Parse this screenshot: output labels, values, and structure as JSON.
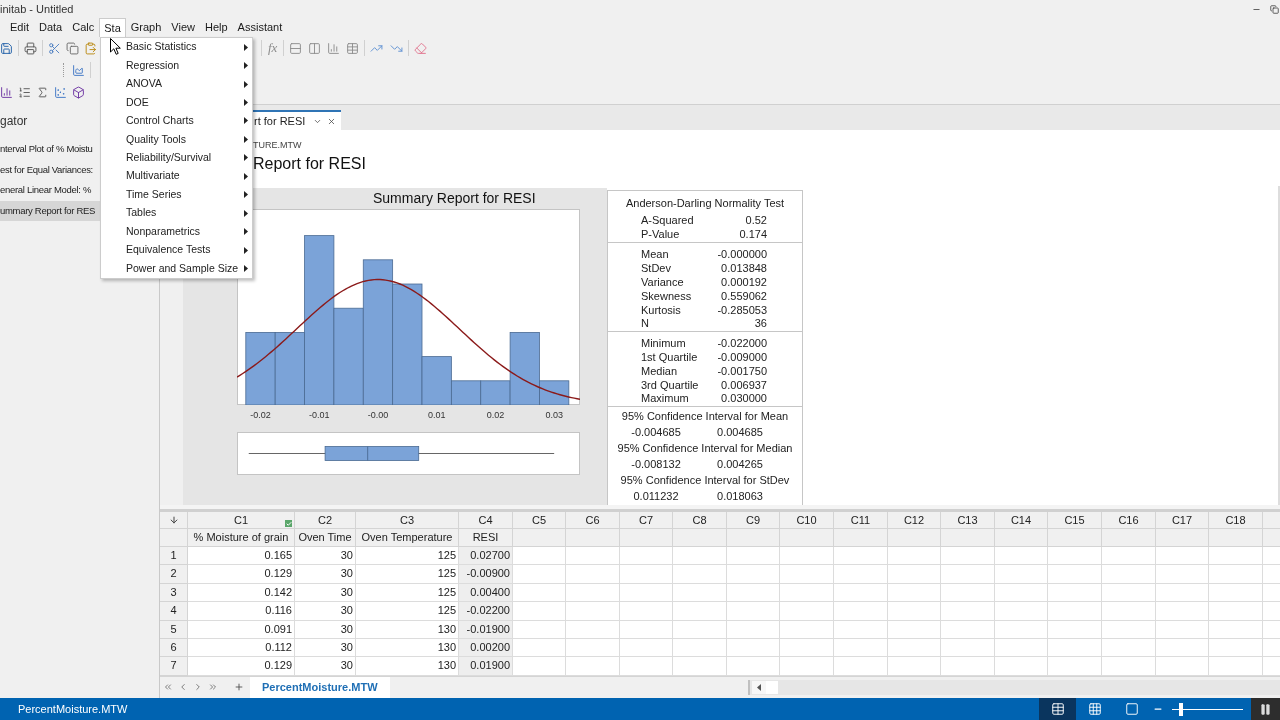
{
  "window": {
    "title": "initab - Untitled"
  },
  "menu_bar": [
    {
      "label": "Edit",
      "selected": false
    },
    {
      "label": "Data",
      "selected": false
    },
    {
      "label": "Calc",
      "selected": false
    },
    {
      "label": "Sta",
      "selected": true
    },
    {
      "label": "Graph",
      "selected": false
    },
    {
      "label": "View",
      "selected": false
    },
    {
      "label": "Help",
      "selected": false
    },
    {
      "label": "Assistant",
      "selected": false
    }
  ],
  "toolbar": {
    "function_label": "fx"
  },
  "stat_menu": {
    "items": [
      {
        "label": "Basic Statistics",
        "submenu": true
      },
      {
        "label": "Regression",
        "submenu": true
      },
      {
        "label": "ANOVA",
        "submenu": true
      },
      {
        "label": "DOE",
        "submenu": true
      },
      {
        "label": "Control Charts",
        "submenu": true
      },
      {
        "label": "Quality Tools",
        "submenu": true
      },
      {
        "label": "Reliability/Survival",
        "submenu": true
      },
      {
        "label": "Multivariate",
        "submenu": true
      },
      {
        "label": "Time Series",
        "submenu": true
      },
      {
        "label": "Tables",
        "submenu": true
      },
      {
        "label": "Nonparametrics",
        "submenu": true
      },
      {
        "label": "Equivalence Tests",
        "submenu": true
      },
      {
        "label": "Power and Sample Size",
        "submenu": true
      }
    ]
  },
  "navigator": {
    "title": "gator",
    "items": [
      {
        "label": "nterval Plot of % Moistu",
        "selected": false
      },
      {
        "label": "est for Equal Variances:",
        "selected": false
      },
      {
        "label": "eneral Linear Model: %",
        "selected": false
      },
      {
        "label": "ummary Report for RES",
        "selected": true
      }
    ]
  },
  "output": {
    "tab": {
      "label": "rt for RESI",
      "selected": true
    },
    "source": "TURE.MTW",
    "heading": "Report for RESI",
    "graph": {
      "title": "Summary Report for RESI",
      "axis_labels": [
        "-0.02",
        "-0.01",
        "-0.00",
        "0.01",
        "0.02",
        "0.03"
      ]
    },
    "summary_table": {
      "title": "Anderson-Darling Normality Test",
      "sections": [
        {
          "rows": [
            {
              "label": "A-Squared",
              "value": "0.52"
            },
            {
              "label": "P-Value",
              "value": "0.174"
            }
          ]
        },
        {
          "rows": [
            {
              "label": "Mean",
              "value": "-0.000000"
            },
            {
              "label": "StDev",
              "value": "0.013848"
            },
            {
              "label": "Variance",
              "value": "0.000192"
            },
            {
              "label": "Skewness",
              "value": "0.559062"
            },
            {
              "label": "Kurtosis",
              "value": "-0.285053"
            },
            {
              "label": "N",
              "value": "36"
            }
          ]
        },
        {
          "rows": [
            {
              "label": "Minimum",
              "value": "-0.022000"
            },
            {
              "label": "1st Quartile",
              "value": "-0.009000"
            },
            {
              "label": "Median",
              "value": "-0.001750"
            },
            {
              "label": "3rd Quartile",
              "value": "0.006937"
            },
            {
              "label": "Maximum",
              "value": "0.030000"
            }
          ]
        }
      ],
      "intervals": [
        {
          "title": "95% Confidence Interval for Mean",
          "low": "-0.004685",
          "high": "0.004685"
        },
        {
          "title": "95% Confidence Interval for Median",
          "low": "-0.008132",
          "high": "0.004265"
        },
        {
          "title": "95% Confidence Interval for StDev",
          "low": "0.011232",
          "high": "0.018063"
        }
      ]
    }
  },
  "worksheet": {
    "columns": [
      {
        "id": "C1",
        "name": "% Moisture of grain",
        "checked": true,
        "shaded": false
      },
      {
        "id": "C2",
        "name": "Oven Time",
        "checked": false,
        "shaded": false
      },
      {
        "id": "C3",
        "name": "Oven Temperature",
        "checked": false,
        "shaded": false
      },
      {
        "id": "C4",
        "name": "RESI",
        "checked": false,
        "shaded": true
      },
      {
        "id": "C5",
        "checked": false,
        "shaded": false
      },
      {
        "id": "C6",
        "checked": false,
        "shaded": false
      },
      {
        "id": "C7",
        "checked": false,
        "shaded": false
      },
      {
        "id": "C8",
        "checked": false,
        "shaded": false
      },
      {
        "id": "C9",
        "checked": false,
        "shaded": false
      },
      {
        "id": "C10",
        "checked": false,
        "shaded": false
      },
      {
        "id": "C11",
        "checked": false,
        "shaded": false
      },
      {
        "id": "C12",
        "checked": false,
        "shaded": false
      },
      {
        "id": "C13",
        "checked": false,
        "shaded": false
      },
      {
        "id": "C14",
        "checked": false,
        "shaded": false
      },
      {
        "id": "C15",
        "checked": false,
        "shaded": false
      },
      {
        "id": "C16",
        "checked": false,
        "shaded": false
      },
      {
        "id": "C17",
        "checked": false,
        "shaded": false
      },
      {
        "id": "C18",
        "checked": false,
        "shaded": false
      }
    ],
    "rows": [
      {
        "number": "1",
        "cells": [
          "0.165",
          "30",
          "125",
          "0.02700"
        ]
      },
      {
        "number": "2",
        "cells": [
          "0.129",
          "30",
          "125",
          "-0.00900"
        ]
      },
      {
        "number": "3",
        "cells": [
          "0.142",
          "30",
          "125",
          "0.00400"
        ]
      },
      {
        "number": "4",
        "cells": [
          "0.116",
          "30",
          "125",
          "-0.02200"
        ]
      },
      {
        "number": "5",
        "cells": [
          "0.091",
          "30",
          "130",
          "-0.01900"
        ]
      },
      {
        "number": "6",
        "cells": [
          "0.112",
          "30",
          "130",
          "0.00200"
        ]
      },
      {
        "number": "7",
        "cells": [
          "0.129",
          "30",
          "130",
          "0.01900"
        ]
      }
    ]
  },
  "sheet_tabs": [
    {
      "label": "PercentMoisture.MTW",
      "selected": true
    }
  ],
  "status_bar": {
    "text": "PercentMoisture.MTW",
    "views": [
      {
        "kind": "worksheet",
        "selected": true
      },
      {
        "kind": "grid",
        "selected": false
      },
      {
        "kind": "single",
        "selected": false
      }
    ],
    "zoom": {
      "level": 0.13
    }
  }
}
